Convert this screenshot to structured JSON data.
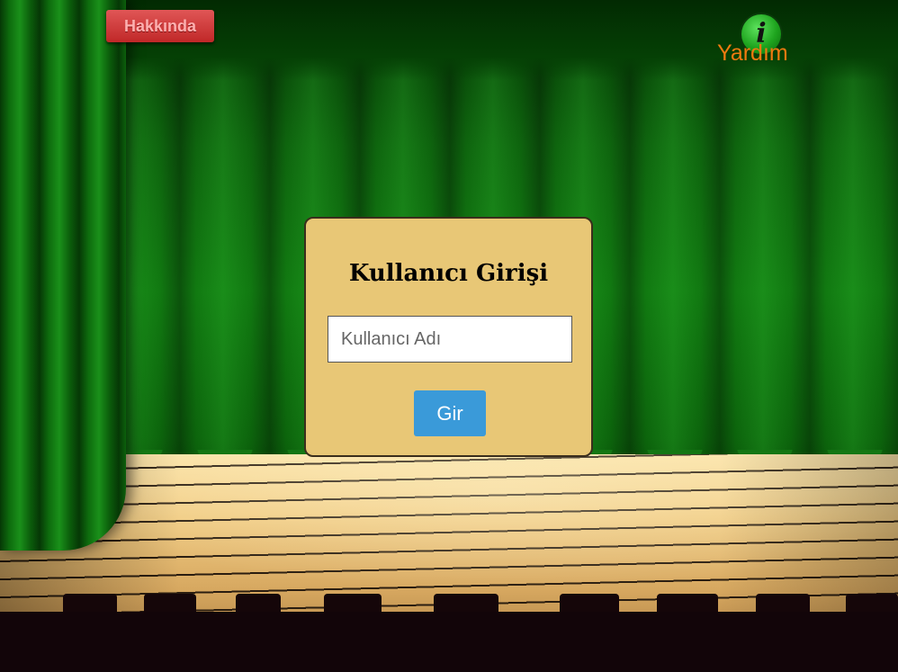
{
  "header": {
    "about_label": "Hakkında",
    "help_label": "Yardım",
    "help_icon": "info-icon",
    "about_color": "#c93434",
    "help_color": "#f07a10"
  },
  "login": {
    "title": "Kullanıcı Girişi",
    "username_placeholder": "Kullanıcı Adı",
    "username_value": "",
    "submit_label": "Gir",
    "card_color": "#e8c776",
    "button_color": "#3a9ad9"
  },
  "scene": {
    "background": "theater-stage",
    "curtain_color": "#128012"
  }
}
